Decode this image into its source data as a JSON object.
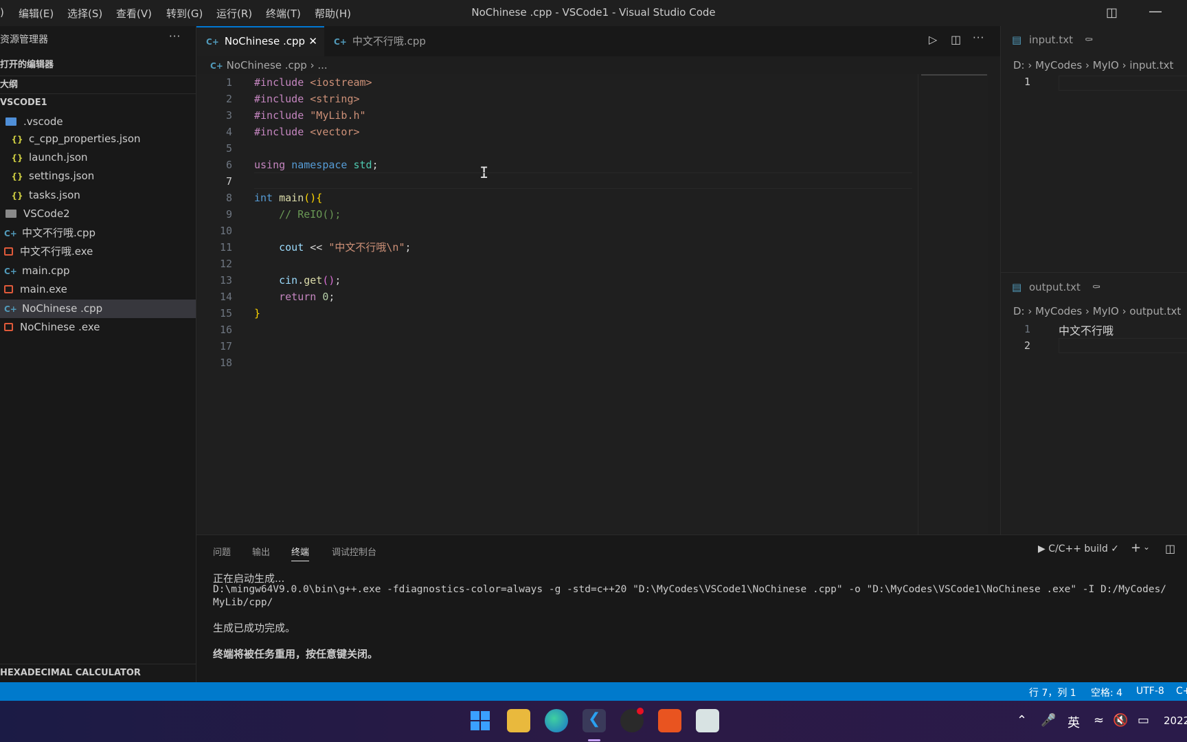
{
  "titlebar": {
    "menus": [
      "编辑(E)",
      "选择(S)",
      "查看(V)",
      "转到(G)",
      "运行(R)",
      "终端(T)",
      "帮助(H)"
    ],
    "menu_partial": ")",
    "title": "NoChinese .cpp - VSCode1 - Visual Studio Code"
  },
  "sidebar": {
    "explorer_title": "资源管理器",
    "more_label": "···",
    "open_editors": "打开的编辑器",
    "outline": "大纲",
    "workspace": "VSCODE1",
    "files": [
      {
        "name": ".vscode",
        "kind": "folder-vscode"
      },
      {
        "name": "c_cpp_properties.json",
        "kind": "json"
      },
      {
        "name": "launch.json",
        "kind": "json"
      },
      {
        "name": "settings.json",
        "kind": "json"
      },
      {
        "name": "tasks.json",
        "kind": "json"
      },
      {
        "name": "VSCode2",
        "kind": "folder"
      },
      {
        "name": "中文不行哦.cpp",
        "kind": "cpp"
      },
      {
        "name": "中文不行哦.exe",
        "kind": "exe"
      },
      {
        "name": "main.cpp",
        "kind": "cpp"
      },
      {
        "name": "main.exe",
        "kind": "exe"
      },
      {
        "name": "NoChinese .cpp",
        "kind": "cpp",
        "selected": true
      },
      {
        "name": "NoChinese .exe",
        "kind": "exe"
      }
    ],
    "bottom_section": "HEXADECIMAL CALCULATOR"
  },
  "tabs": [
    {
      "label": "NoChinese .cpp",
      "active": true
    },
    {
      "label": "中文不行哦.cpp",
      "active": false
    }
  ],
  "breadcrumb": {
    "file": "NoChinese .cpp",
    "rest": "..."
  },
  "editor": {
    "line_numbers": [
      "1",
      "2",
      "3",
      "4",
      "5",
      "6",
      "7",
      "8",
      "9",
      "10",
      "11",
      "12",
      "13",
      "14",
      "15",
      "16",
      "17",
      "18"
    ],
    "current_line": "7"
  },
  "right_panel": {
    "input": {
      "tab": "input.txt",
      "crumbs": [
        "D:",
        "MyCodes",
        "MyIO",
        "input.txt"
      ],
      "lines": [
        {
          "n": "1",
          "text": ""
        }
      ]
    },
    "output": {
      "tab": "output.txt",
      "crumbs": [
        "D:",
        "MyCodes",
        "MyIO",
        "output.txt"
      ],
      "lines": [
        {
          "n": "1",
          "text": "中文不行哦"
        },
        {
          "n": "2",
          "text": ""
        }
      ]
    }
  },
  "panel": {
    "tabs": [
      "问题",
      "输出",
      "终端",
      "调试控制台"
    ],
    "active_tab": "终端",
    "terminal_name": "C/C++ build",
    "terminal_lines": [
      "正在启动生成...",
      "D:\\mingw64V9.0.0\\bin\\g++.exe -fdiagnostics-color=always -g -std=c++20 \"D:\\MyCodes\\VSCode1\\NoChinese .cpp\" -o \"D:\\MyCodes\\VSCode1\\NoChinese .exe\" -I D:/MyCodes/",
      "MyLib/cpp/",
      "",
      "生成已成功完成。",
      "",
      "终端将被任务重用，按任意键关闭。"
    ]
  },
  "statusbar": {
    "position": "行 7，列 1",
    "spaces": "空格: 4",
    "encoding": "UTF-8",
    "language": "C++"
  },
  "taskbar": {
    "ime": "英",
    "clock": "2022"
  },
  "colors": {
    "accent": "#007acc",
    "editor_bg": "#1f1f1f",
    "sidebar_bg": "#181818"
  }
}
